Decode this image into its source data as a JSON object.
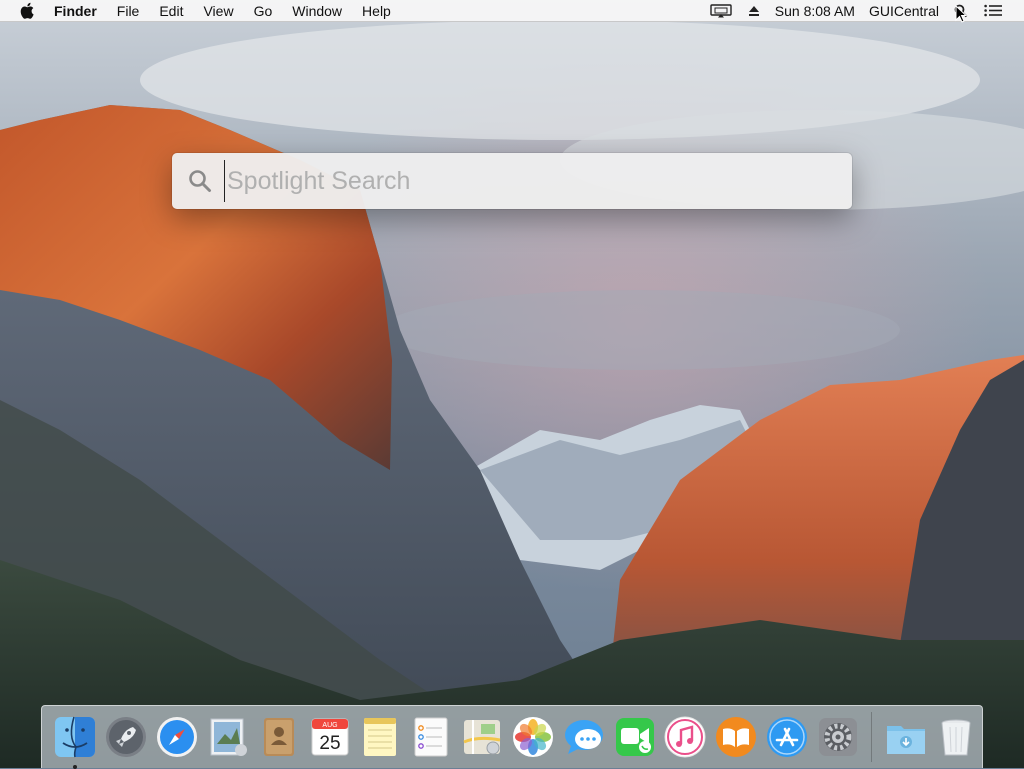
{
  "menubar": {
    "apple_icon": "apple-logo-icon",
    "app_name": "Finder",
    "menus": [
      "File",
      "Edit",
      "View",
      "Go",
      "Window",
      "Help"
    ],
    "status": {
      "display_icon": "airplay-display-icon",
      "eject_icon": "eject-icon",
      "clock": "Sun 8:08 AM",
      "user": "GUICentral",
      "spotlight_icon": "spotlight-search-icon",
      "notifications_icon": "notification-center-icon"
    }
  },
  "spotlight": {
    "placeholder": "Spotlight Search",
    "value": "",
    "icon": "magnifier-icon"
  },
  "dock": {
    "apps": [
      {
        "name": "Finder",
        "icon": "finder-icon",
        "running": true
      },
      {
        "name": "Launchpad",
        "icon": "launchpad-rocket-icon",
        "running": false
      },
      {
        "name": "Safari",
        "icon": "safari-compass-icon",
        "running": false
      },
      {
        "name": "Mail",
        "icon": "mail-stamp-icon",
        "running": false
      },
      {
        "name": "Contacts",
        "icon": "contacts-book-icon",
        "running": false
      },
      {
        "name": "Calendar",
        "icon": "calendar-icon",
        "running": false,
        "month": "AUG",
        "day": "25"
      },
      {
        "name": "Notes",
        "icon": "notes-icon",
        "running": false
      },
      {
        "name": "Reminders",
        "icon": "reminders-icon",
        "running": false
      },
      {
        "name": "Maps",
        "icon": "maps-icon",
        "running": false
      },
      {
        "name": "Photos",
        "icon": "photos-flower-icon",
        "running": false
      },
      {
        "name": "Messages",
        "icon": "messages-bubble-icon",
        "running": false
      },
      {
        "name": "FaceTime",
        "icon": "facetime-camera-icon",
        "running": false
      },
      {
        "name": "iTunes",
        "icon": "itunes-note-icon",
        "running": false
      },
      {
        "name": "iBooks",
        "icon": "ibooks-book-icon",
        "running": false
      },
      {
        "name": "App Store",
        "icon": "app-store-icon",
        "running": false
      },
      {
        "name": "System Preferences",
        "icon": "system-preferences-gear-icon",
        "running": false
      }
    ],
    "stacks": [
      {
        "name": "Downloads",
        "icon": "downloads-folder-icon"
      },
      {
        "name": "Trash",
        "icon": "trash-icon"
      }
    ]
  },
  "colors": {
    "menubar_bg": "#f6f6f6",
    "spotlight_bg": "#eeeeee",
    "placeholder": "#b0b0b0"
  }
}
